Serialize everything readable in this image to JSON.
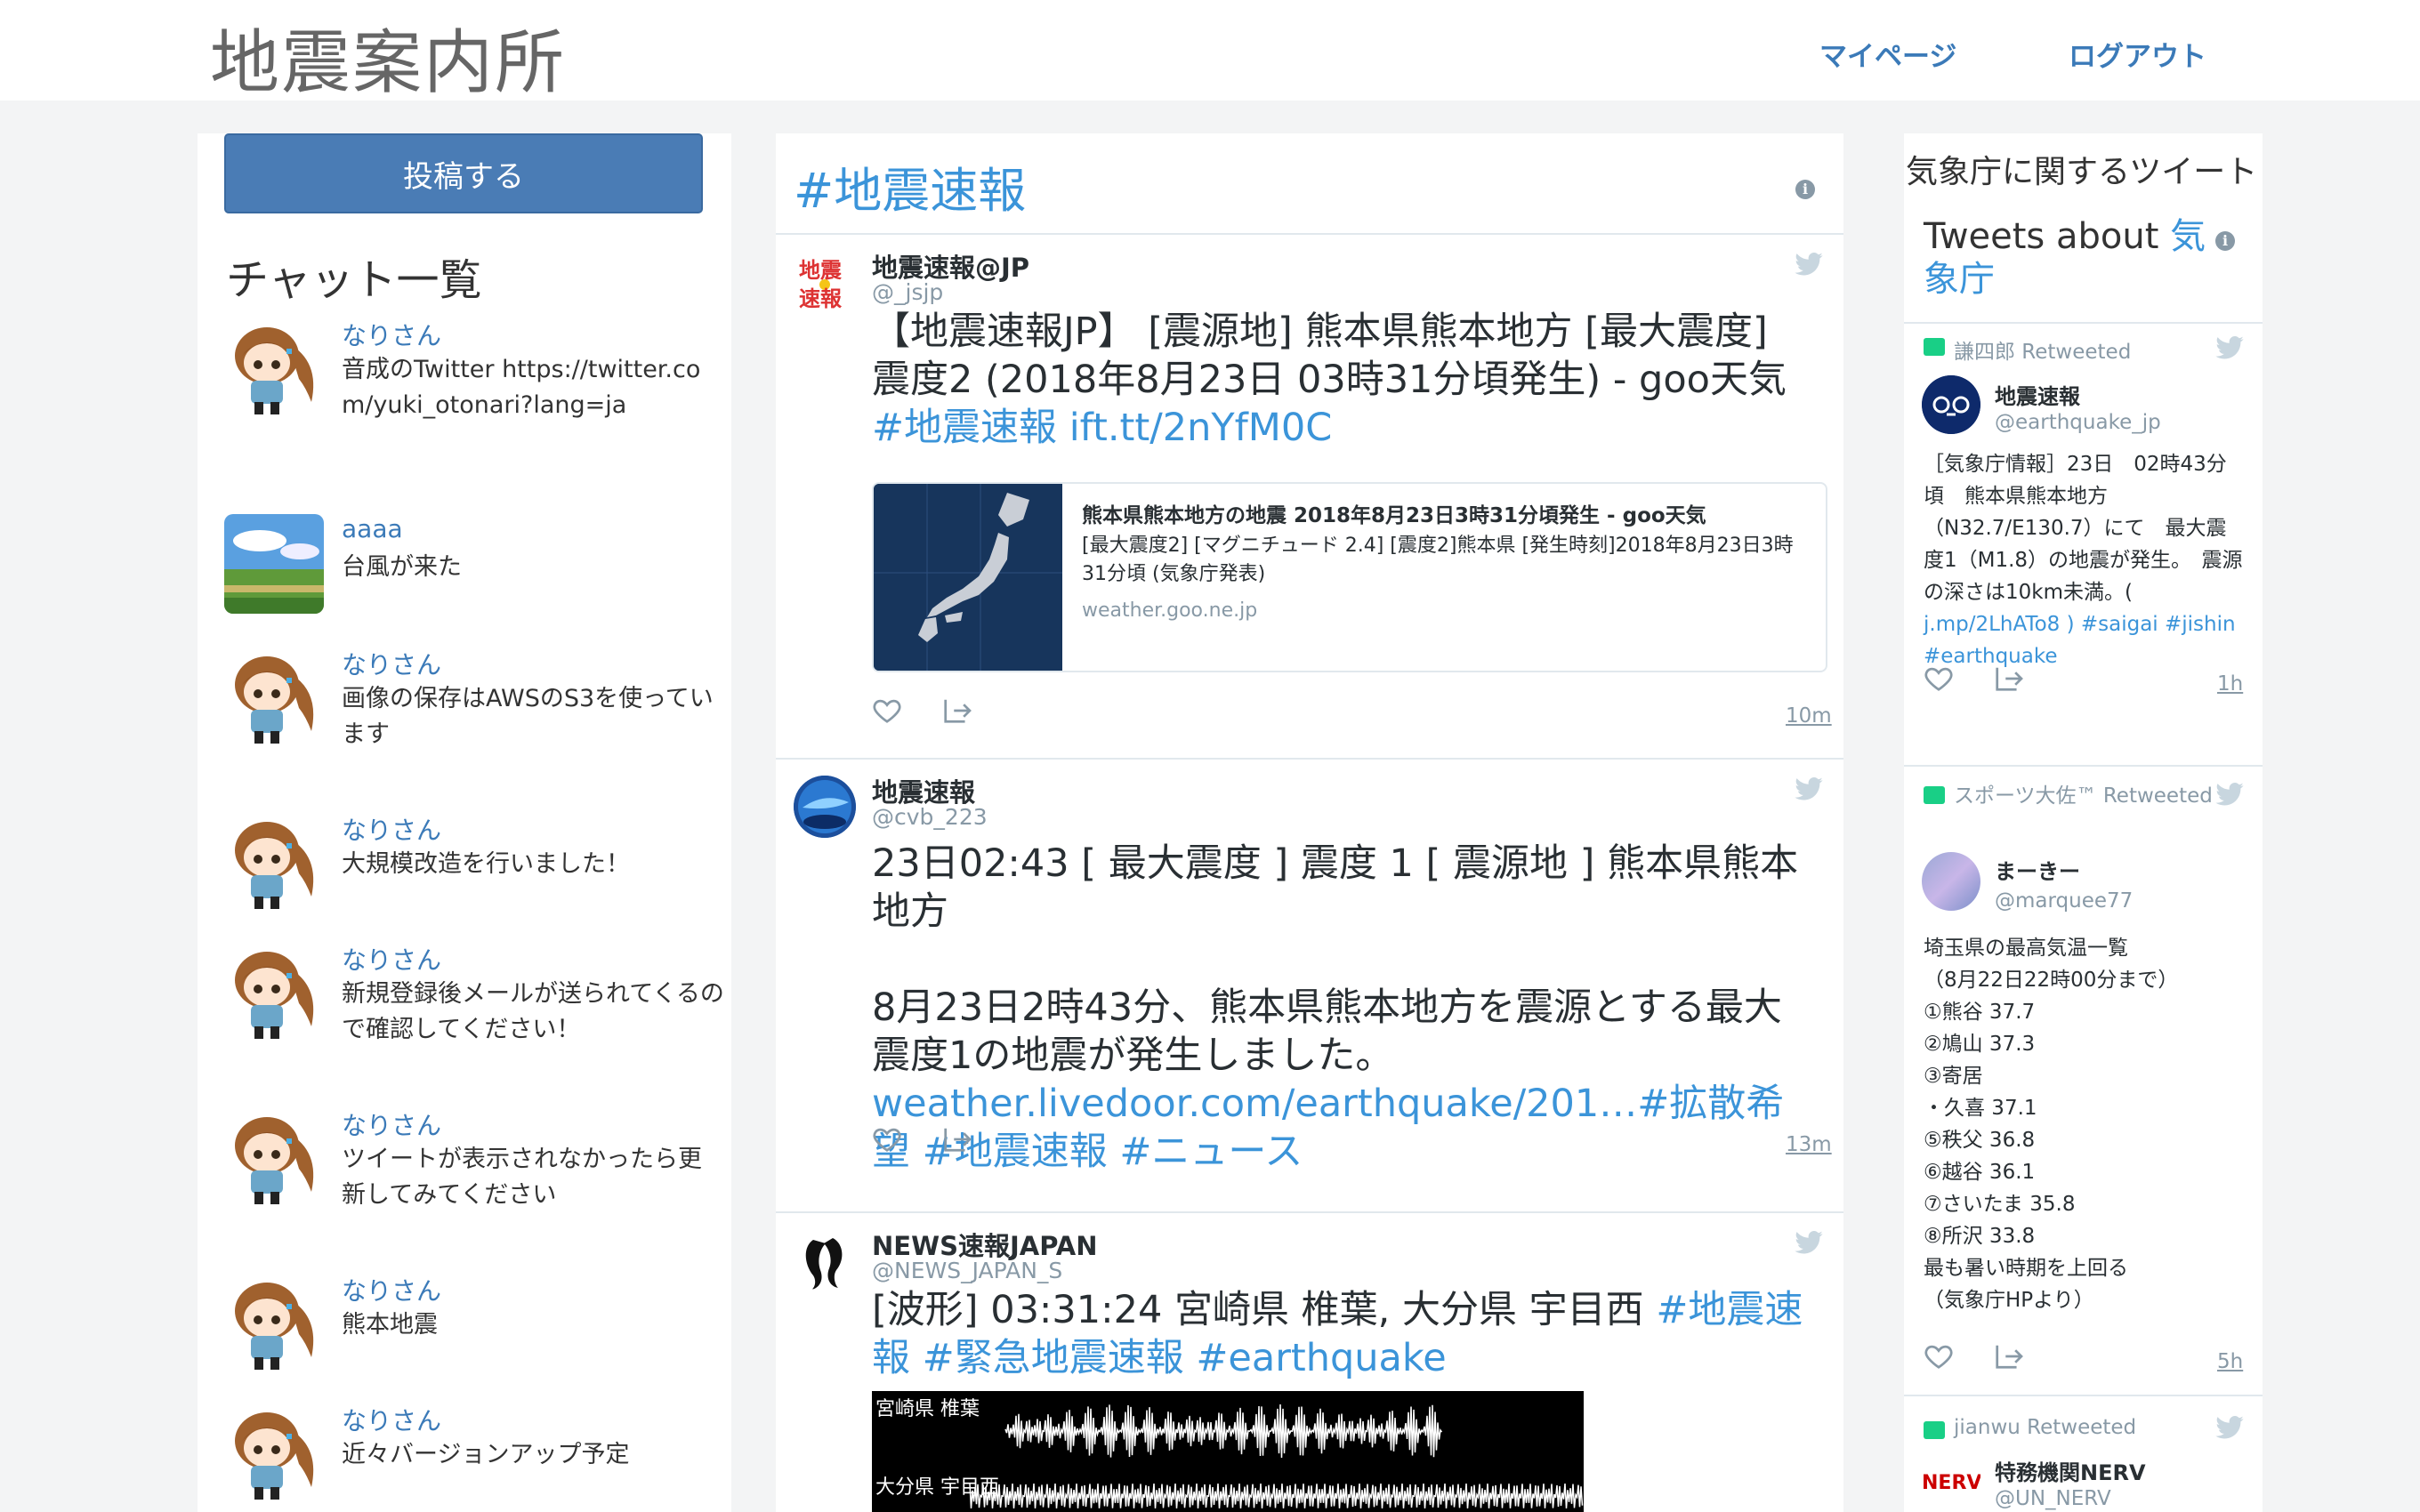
{
  "header": {
    "logo": "地震案内所",
    "nav_mypage": "マイページ",
    "nav_logout": "ログアウト"
  },
  "left": {
    "post_button": "投稿する",
    "chat_title": "チャット一覧",
    "chats": [
      {
        "name": "なりさん",
        "message": "音成のTwitter https://twitter.com/yuki_otonari?lang=ja",
        "avatar": "anime-girl-avatar"
      },
      {
        "name": "aaaa",
        "message": "台風が来た",
        "avatar": "landscape-avatar"
      },
      {
        "name": "なりさん",
        "message": "画像の保存はAWSのS3を使っています",
        "avatar": "anime-girl-avatar"
      },
      {
        "name": "なりさん",
        "message": "大規模改造を行いました！",
        "avatar": "anime-girl-avatar"
      },
      {
        "name": "なりさん",
        "message": "新規登録後メールが送られてくるので確認してください！",
        "avatar": "anime-girl-avatar"
      },
      {
        "name": "なりさん",
        "message": "ツイートが表示されなかったら更新してみてください",
        "avatar": "anime-girl-avatar"
      },
      {
        "name": "なりさん",
        "message": "熊本地震",
        "avatar": "anime-girl-avatar"
      },
      {
        "name": "なりさん",
        "message": "近々バージョンアップ予定",
        "avatar": "anime-girl-avatar"
      }
    ]
  },
  "timeline": {
    "title": "#地震速報",
    "tweets": [
      {
        "name": "地震速報@JP",
        "handle": "@_jsjp",
        "text": "【地震速報JP】 [震源地] 熊本県熊本地方 [最大震度] 震度2 (2018年8月23日 03時31分頃発生) - goo天気 ",
        "links": "#地震速報 ift.tt/2nYfM0C",
        "card_title": "熊本県熊本地方の地震 2018年8月23日3時31分頃発生 - goo天気",
        "card_desc": "[最大震度2] [マグニチュード 2.4] [震度2]熊本県 [発生時刻]2018年8月23日3時31分頃 (気象庁発表)",
        "card_domain": "weather.goo.ne.jp",
        "time": "10m"
      },
      {
        "name": "地震速報",
        "handle": "@cvb_223",
        "text_line1": "23日02:43 [ 最大震度 ] 震度 1 [ 震源地 ] 熊本県熊本地方",
        "text_line2": "8月23日2時43分、熊本県熊本地方を震源とする最大震度1の地震が発生しました。",
        "links": "weather.livedoor.com/earthquake/201…#拡散希望 #地震速報 #ニュース",
        "time": "13m"
      },
      {
        "name": "NEWS速報JAPAN",
        "handle": "@NEWS_JAPAN_S",
        "text": "[波形]  03:31:24 宮崎県 椎葉, 大分県 宇目西 ",
        "links": "#地震速報 #緊急地震速報 #earthquake",
        "wave_label1": "宮崎県 椎葉",
        "wave_label2": "大分県 宇目西"
      }
    ]
  },
  "sidebar": {
    "heading": "気象庁に関するツイート",
    "sub_prefix": "Tweets about ",
    "sub_link": "気象庁",
    "tweets": [
      {
        "retweeted_by": "謙四郎 Retweeted",
        "name": "地震速報",
        "handle": "@earthquake_jp",
        "text": "［気象庁情報］23日　02時43分頃　熊本県熊本地方（N32.7/E130.7）にて　最大震度1（M1.8）の地震が発生。　震源の深さは10km未満。(",
        "links": "j.mp/2LhATo8 ) #saigai #jishin #earthquake",
        "time": "1h"
      },
      {
        "retweeted_by": "スポーツ大佐™ Retweeted",
        "name": "まーきー",
        "handle": "@marquee77",
        "lines": [
          "埼玉県の最高気温一覧",
          "（8月22日22時00分まで）",
          "①熊谷 37.7",
          "②鳩山 37.3",
          "③寄居",
          "・久喜 37.1",
          "⑤秩父 36.8",
          "⑥越谷 36.1",
          "⑦さいたま 35.8",
          "⑧所沢 33.8",
          "最も暑い時期を上回る",
          "（気象庁HPより）"
        ],
        "time": "5h"
      },
      {
        "retweeted_by": "jianwu Retweeted",
        "name": "特務機関NERV",
        "handle": "@UN_NERV"
      }
    ]
  },
  "colors": {
    "accent": "#3b94d9",
    "button": "#4a7cb5",
    "muted": "#8899a6",
    "retweet": "#19cf86"
  }
}
